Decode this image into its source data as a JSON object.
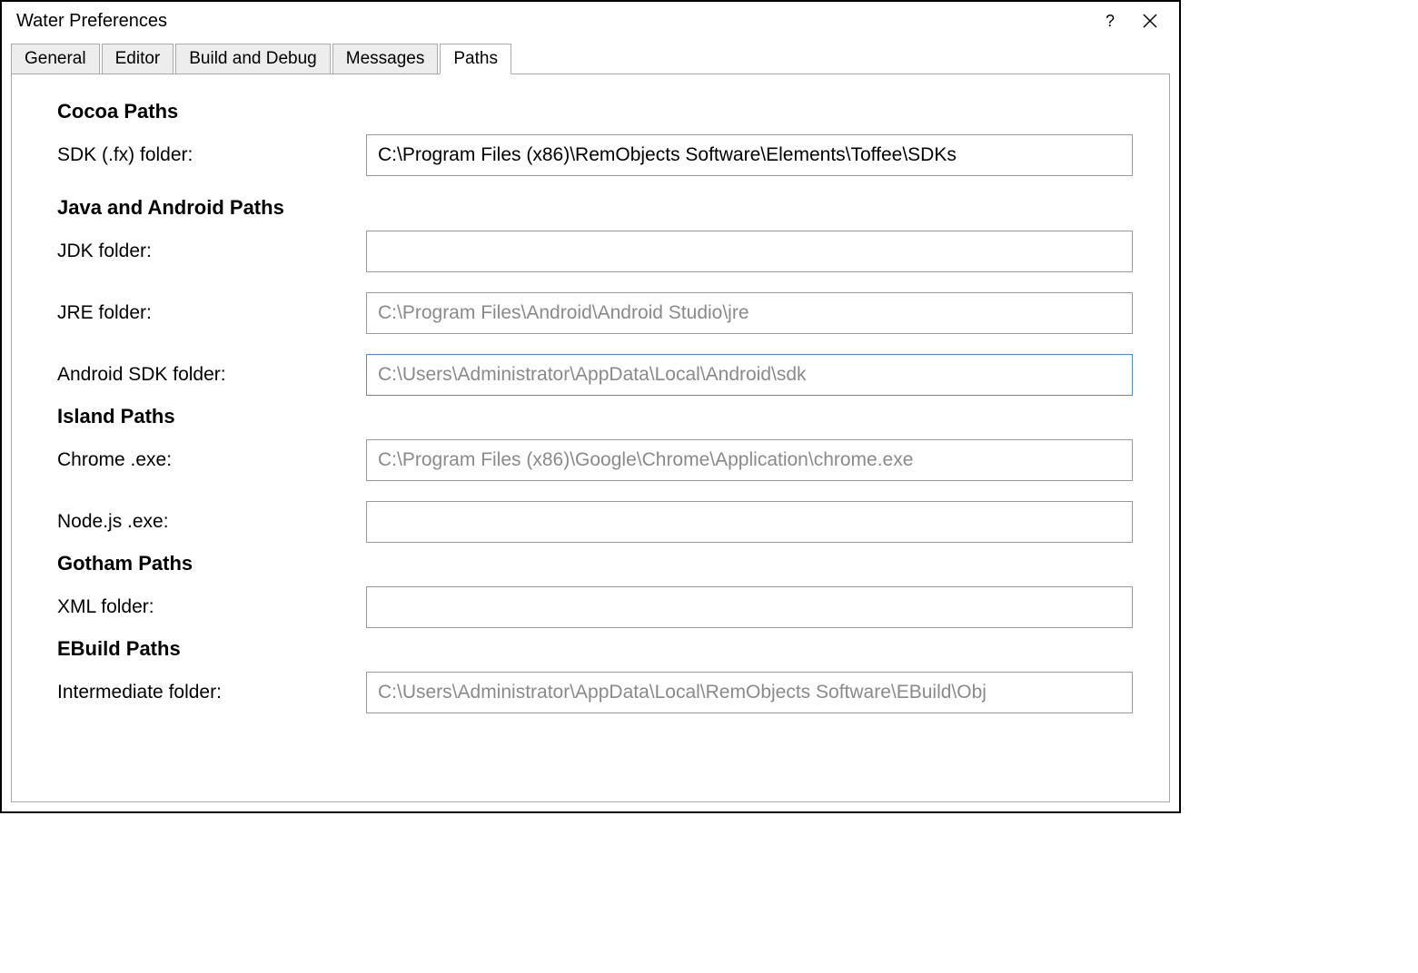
{
  "window": {
    "title": "Water Preferences"
  },
  "tabs": {
    "general": "General",
    "editor": "Editor",
    "build": "Build and Debug",
    "messages": "Messages",
    "paths": "Paths",
    "active": "paths"
  },
  "sections": {
    "cocoa_title": "Cocoa Paths",
    "java_title": "Java and Android Paths",
    "island_title": "Island Paths",
    "gotham_title": "Gotham Paths",
    "ebuild_title": "EBuild Paths"
  },
  "fields": {
    "sdk_fx": {
      "label": "SDK (.fx) folder:",
      "value": "C:\\Program Files (x86)\\RemObjects Software\\Elements\\Toffee\\SDKs",
      "placeholder": ""
    },
    "jdk": {
      "label": "JDK folder:",
      "value": "",
      "placeholder": ""
    },
    "jre": {
      "label": "JRE folder:",
      "value": "",
      "placeholder": "C:\\Program Files\\Android\\Android Studio\\jre"
    },
    "android": {
      "label": "Android SDK folder:",
      "value": "",
      "placeholder": "C:\\Users\\Administrator\\AppData\\Local\\Android\\sdk"
    },
    "chrome": {
      "label": "Chrome .exe:",
      "value": "",
      "placeholder": "C:\\Program Files (x86)\\Google\\Chrome\\Application\\chrome.exe"
    },
    "node": {
      "label": "Node.js .exe:",
      "value": "",
      "placeholder": ""
    },
    "xml": {
      "label": "XML folder:",
      "value": "",
      "placeholder": ""
    },
    "interm": {
      "label": "Intermediate folder:",
      "value": "",
      "placeholder": "C:\\Users\\Administrator\\AppData\\Local\\RemObjects Software\\EBuild\\Obj"
    }
  }
}
